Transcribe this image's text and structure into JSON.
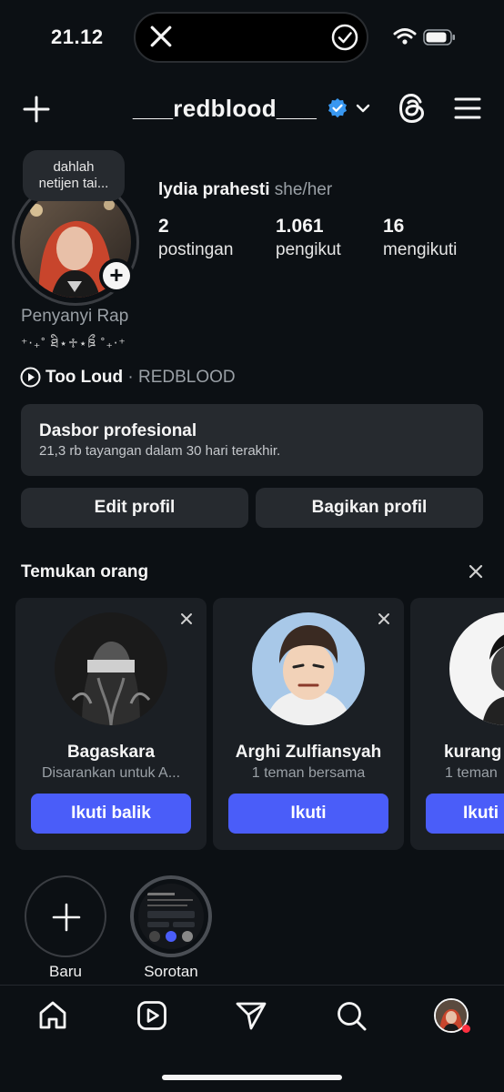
{
  "status_bar": {
    "time": "21.12",
    "island_icons": [
      "x-logo-icon",
      "checkmark-circle-icon"
    ],
    "icons": [
      "wifi-icon",
      "battery-icon"
    ]
  },
  "header": {
    "username": "___redblood___",
    "verified": true,
    "icons": [
      "plus-icon",
      "chevron-down-icon",
      "threads-icon",
      "menu-icon"
    ]
  },
  "profile": {
    "note": [
      "dahlah",
      "netijen tai..."
    ],
    "full_name": "lydia prahesti",
    "pronouns": "she/her",
    "category": "Penyanyi Rap",
    "bio_deco": "⁺‧₊˚ ཐི⋆♱⋆ཋྀ ˚₊‧⁺",
    "stats": [
      {
        "value": "2",
        "label": "postingan"
      },
      {
        "value": "1.061",
        "label": "pengikut"
      },
      {
        "value": "16",
        "label": "mengikuti"
      }
    ],
    "music": {
      "title": "Too Loud",
      "separator": " · ",
      "artist": "REDBLOOD"
    }
  },
  "dashboard": {
    "title": "Dasbor profesional",
    "subtitle": "21,3 rb tayangan dalam 30 hari terakhir."
  },
  "buttons": {
    "edit": "Edit profil",
    "share": "Bagikan profil"
  },
  "discover": {
    "title": "Temukan orang",
    "cards": [
      {
        "name": "Bagaskara",
        "subtitle": "Disarankan untuk A...",
        "button": "Ikuti balik"
      },
      {
        "name": "Arghi Zulfiansyah",
        "subtitle": "1 teman bersama",
        "button": "Ikuti"
      },
      {
        "name": "kurang",
        "subtitle": "1 teman",
        "button": "Ikuti"
      }
    ]
  },
  "highlights": [
    {
      "label": "Baru"
    },
    {
      "label": "Sorotan"
    }
  ],
  "nav": {
    "icons": [
      "home-icon",
      "reels-icon",
      "send-icon",
      "search-icon",
      "profile-avatar"
    ],
    "notification_dot_color": "#ff3040"
  },
  "colors": {
    "background": "#0c1014",
    "surface": "#262a2f",
    "accent": "#4a5df9",
    "verified": "#3897f0"
  }
}
